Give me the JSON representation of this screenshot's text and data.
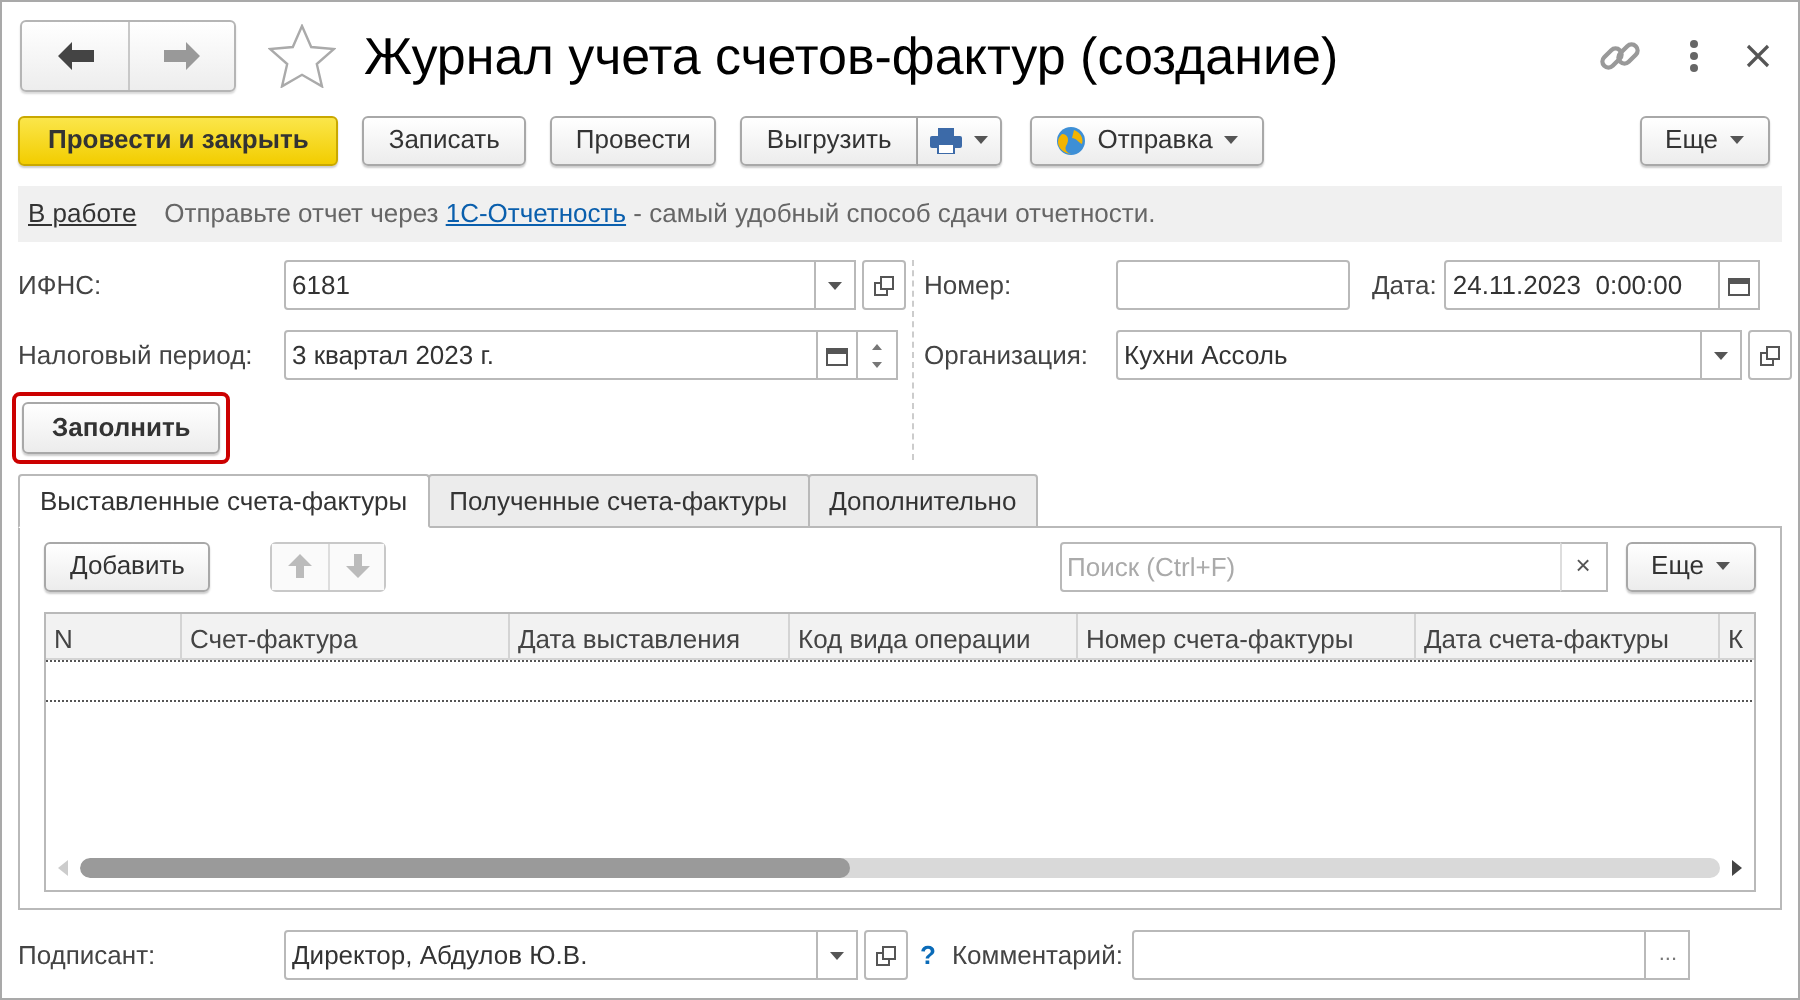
{
  "window": {
    "title": "Журнал учета счетов-фактур (создание)",
    "favorite": false
  },
  "toolbar": [
    {
      "kind": "primary",
      "label": "Провести и закрыть"
    },
    {
      "kind": "plain",
      "label": "Записать"
    },
    {
      "kind": "plain",
      "label": "Провести"
    },
    {
      "kind": "split_print",
      "label": "Выгрузить"
    },
    {
      "kind": "send_menu",
      "label": "Отправка"
    },
    {
      "kind": "menu",
      "label": "Еще"
    }
  ],
  "info_bar": {
    "status": "В работе",
    "text_before": "Отправьте отчет через",
    "link": "1С-Отчетность",
    "text_after": "- самый удобный способ сдачи отчетности."
  },
  "header_fields": {
    "ifns": {
      "label": "ИФНС:",
      "value": "6181"
    },
    "number": {
      "label": "Номер:"
    },
    "date": {
      "label": "Дата:",
      "value": "24.11.2023  0:00:00"
    },
    "tax_period": {
      "label": "Налоговый период:",
      "value": "3 квартал 2023 г."
    },
    "organization": {
      "label": "Организация:",
      "value": "Кухни Ассоль"
    }
  },
  "fill_button": {
    "label": "Заполнить",
    "highlighted": true
  },
  "tabs": [
    {
      "label": "Выставленные счета-фактуры",
      "selected": true
    },
    {
      "label": "Полученные счета-фактуры",
      "selected": false
    },
    {
      "label": "Дополнительно",
      "selected": false
    }
  ],
  "table_toolbar": {
    "add_button": "Добавить",
    "move_buttons_disabled": true,
    "search": {
      "placeholder": "Поиск (Ctrl+F)"
    },
    "clear": "×",
    "more": "Еще"
  },
  "table": {
    "columns": [
      "N",
      "Счет-фактура",
      "Дата выставления",
      "Код вида операции",
      "Номер счета-фактуры",
      "Дата счета-фактуры",
      "К"
    ]
  },
  "signer": {
    "label": "Подписант:",
    "value": "Директор, Абдулов Ю.В.",
    "help": "?"
  },
  "comment": {
    "label": "Комментарий:",
    "button": "..."
  }
}
